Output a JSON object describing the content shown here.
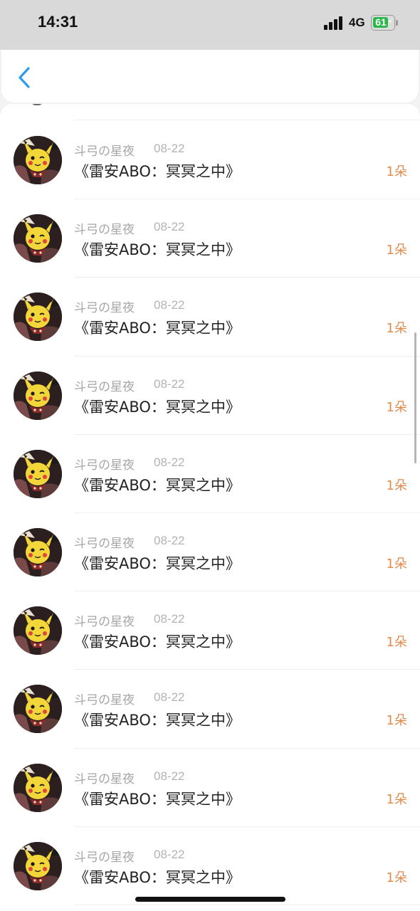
{
  "status_bar": {
    "time": "14:31",
    "network": "4G",
    "battery": "61"
  },
  "nav": {
    "back_icon": "chevron-left-icon"
  },
  "colors": {
    "accent": "#2f9bf0",
    "count": "#e08a4c",
    "meta": "#a6a6a6",
    "battery": "#2bb84a"
  },
  "list": {
    "items": [
      {
        "author": "斗弓の星夜",
        "date": "08-22",
        "title": "《雷安ABO：冥冥之中》",
        "count": "1朵"
      },
      {
        "author": "斗弓の星夜",
        "date": "08-22",
        "title": "《雷安ABO：冥冥之中》",
        "count": "1朵"
      },
      {
        "author": "斗弓の星夜",
        "date": "08-22",
        "title": "《雷安ABO：冥冥之中》",
        "count": "1朵"
      },
      {
        "author": "斗弓の星夜",
        "date": "08-22",
        "title": "《雷安ABO：冥冥之中》",
        "count": "1朵"
      },
      {
        "author": "斗弓の星夜",
        "date": "08-22",
        "title": "《雷安ABO：冥冥之中》",
        "count": "1朵"
      },
      {
        "author": "斗弓の星夜",
        "date": "08-22",
        "title": "《雷安ABO：冥冥之中》",
        "count": "1朵"
      },
      {
        "author": "斗弓の星夜",
        "date": "08-22",
        "title": "《雷安ABO：冥冥之中》",
        "count": "1朵"
      },
      {
        "author": "斗弓の星夜",
        "date": "08-22",
        "title": "《雷安ABO：冥冥之中》",
        "count": "1朵"
      },
      {
        "author": "斗弓の星夜",
        "date": "08-22",
        "title": "《雷安ABO：冥冥之中》",
        "count": "1朵"
      },
      {
        "author": "斗弓の星夜",
        "date": "08-22",
        "title": "《雷安ABO：冥冥之中》",
        "count": "1朵"
      }
    ]
  }
}
